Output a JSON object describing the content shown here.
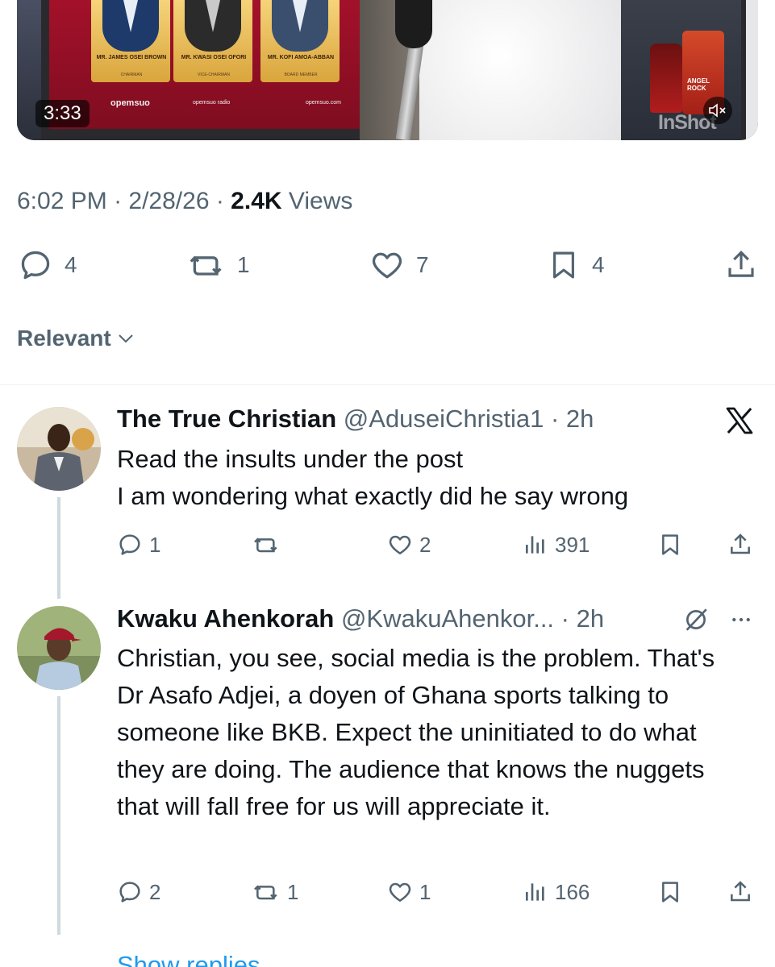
{
  "video": {
    "duration": "3:33",
    "panelists": [
      {
        "name": "MR. JAMES OSEI BROWN",
        "role": "CHAIRMAN"
      },
      {
        "name": "MR. KWASI OSEI OFORI",
        "role": "VICE-CHAIRMAN"
      },
      {
        "name": "MR. KOFI AMOA-ABBAN",
        "role": "BOARD MEMBER"
      }
    ],
    "brand": "opemsuo",
    "social_handle": "opemsuo radio",
    "website": "opemsuo.com",
    "bottle_label": "ANGEL ROCK",
    "watermark": "InShot"
  },
  "post_meta": {
    "time": "6:02 PM",
    "sep1": " · ",
    "date": "2/28/26",
    "sep2": " · ",
    "views_count": "2.4K",
    "views_label": " Views"
  },
  "actions": {
    "replies": "4",
    "reposts": "1",
    "likes": "7",
    "bookmarks": "4"
  },
  "sort": {
    "label": "Relevant"
  },
  "replies": [
    {
      "display_name": "The True Christian",
      "handle": "@AduseiChristia1 · 2h",
      "text": "Read the insults under the post\nI am wondering what exactly did he say wrong",
      "replies": "1",
      "reposts": "",
      "likes": "2",
      "views": "391"
    },
    {
      "display_name": "Kwaku Ahenkorah",
      "handle": "@KwakuAhenkor... · 2h",
      "text": "Christian, you see, social media is the problem. That's Dr Asafo Adjei, a doyen of Ghana sports talking to someone like BKB. Expect the uninitiated to do what they are doing. The audience that knows the nuggets that will fall free for us will appreciate it.",
      "replies": "2",
      "reposts": "1",
      "likes": "1",
      "views": "166"
    }
  ],
  "show_replies": "Show replies",
  "colors": {
    "text": "#0f1419",
    "muted": "#536471",
    "accent": "#1d9bf0",
    "thread_line": "#cfd9de"
  },
  "icons": [
    "reply-icon",
    "repost-icon",
    "like-icon",
    "bookmark-icon",
    "share-icon",
    "views-icon",
    "x-logo-icon",
    "grok-icon",
    "more-icon",
    "chevron-down-icon",
    "mute-icon"
  ]
}
